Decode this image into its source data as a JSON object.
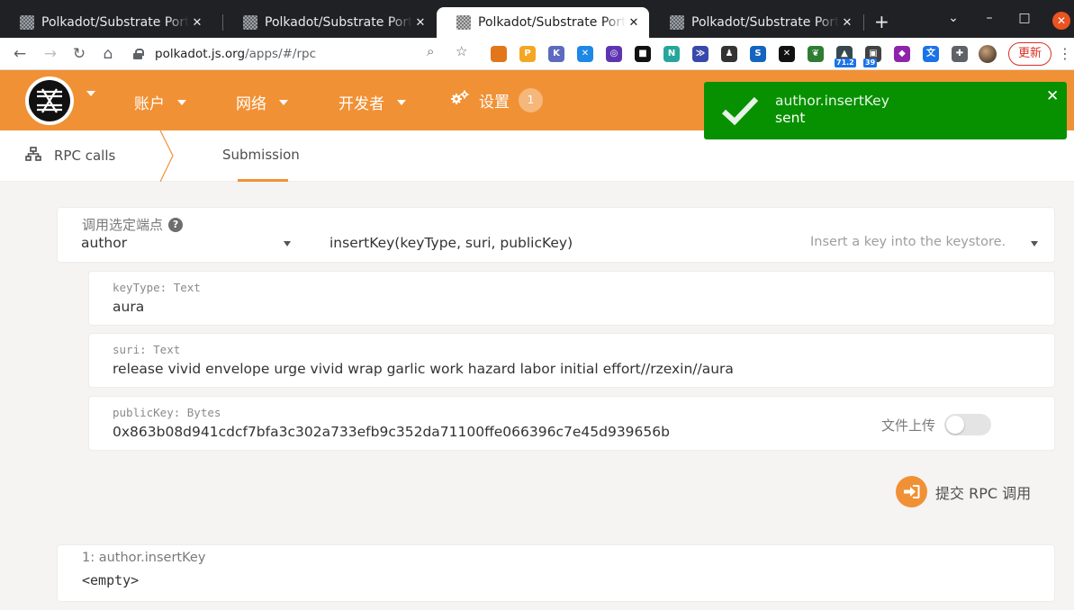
{
  "browser": {
    "tabs": [
      {
        "title": "Polkadot/Substrate Portal",
        "active": false
      },
      {
        "title": "Polkadot/Substrate Portal",
        "active": false
      },
      {
        "title": "Polkadot/Substrate Portal",
        "active": true
      },
      {
        "title": "Polkadot/Substrate Portal",
        "active": false
      }
    ],
    "tab_close": "✕",
    "new_tab": "+",
    "window_buttons": {
      "dropdown": "⌄",
      "minimize": "–",
      "maximize": "□",
      "close": "✕"
    },
    "url_host": "polkadot.js.org",
    "url_path": "/apps/#/rpc",
    "extensions": [
      {
        "icon": "metamask-icon",
        "label": "",
        "color": "#e2761b"
      },
      {
        "icon": "polkadot-ext-icon",
        "label": "P",
        "color": "#f5a623"
      },
      {
        "icon": "kaspersky-icon",
        "label": "K",
        "color": "#5c6bc0"
      },
      {
        "icon": "cross-ext-icon",
        "label": "✕",
        "color": "#1e88e5"
      },
      {
        "icon": "ring-ext-icon",
        "label": "◎",
        "color": "#5e35b1"
      },
      {
        "icon": "cube-ext-icon",
        "label": "■",
        "color": "#111111"
      },
      {
        "icon": "near-ext-icon",
        "label": "N",
        "color": "#26a69a"
      },
      {
        "icon": "chevrons-ext-icon",
        "label": "≫",
        "color": "#3949ab"
      },
      {
        "icon": "pawn-ext-icon",
        "label": "♟",
        "color": "#333333"
      },
      {
        "icon": "s-ext-icon",
        "label": "S",
        "color": "#1565c0"
      },
      {
        "icon": "x-circle-ext-icon",
        "label": "✕",
        "color": "#111111"
      },
      {
        "icon": "leaf-ext-icon",
        "label": "❦",
        "color": "#2e7d32"
      },
      {
        "icon": "triangle-ext-icon",
        "label": "▲",
        "color": "#37474f",
        "badge": "71.2"
      },
      {
        "icon": "image-ext-icon",
        "label": "▣",
        "color": "#424242",
        "badge": "39"
      },
      {
        "icon": "diamond-ext-icon",
        "label": "◆",
        "color": "#8e24aa"
      },
      {
        "icon": "translate-ext-icon",
        "label": "文",
        "color": "#1a73e8"
      },
      {
        "icon": "puzzle-icon",
        "label": "✚",
        "color": "#5f6368"
      }
    ],
    "update_label": "更新",
    "colors": {
      "tabstrip": "#202124",
      "update": "#d93025"
    }
  },
  "app": {
    "nav": {
      "account": "账户",
      "network": "网络",
      "developer": "开发者",
      "settings": "设置",
      "settings_badge": "1"
    },
    "subnav": {
      "rpc_calls": "RPC calls",
      "submission": "Submission"
    },
    "selector": {
      "label": "调用选定端点",
      "help": "?",
      "section": "author",
      "method": "insertKey(keyType, suri, publicKey)",
      "description": "Insert a key into the keystore."
    },
    "params": [
      {
        "label": "keyType: Text",
        "value": "aura"
      },
      {
        "label": "suri: Text",
        "value": "release vivid envelope urge vivid wrap garlic work hazard labor initial effort//rzexin//aura"
      },
      {
        "label": "publicKey: Bytes",
        "value": "0x863b08d941cdcf7bfa3c302a733efb9c352da71100ffe066396c7e45d939656b"
      }
    ],
    "file_upload": "文件上传",
    "file_upload_enabled": false,
    "submit_label": "提交 RPC 调用",
    "result": {
      "label": "1: author.insertKey",
      "value": "<empty>"
    },
    "colors": {
      "accent": "#f19135",
      "toast": "#079100"
    }
  },
  "toast": {
    "title": "author.insertKey",
    "status": "sent",
    "close": "✕"
  }
}
